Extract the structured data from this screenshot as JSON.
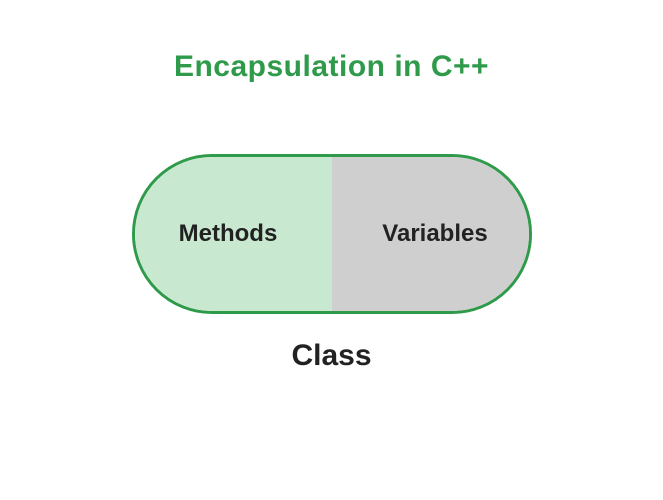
{
  "diagram": {
    "title": "Encapsulation in C++",
    "capsule": {
      "left_label": "Methods",
      "right_label": "Variables"
    },
    "bottom_label": "Class",
    "colors": {
      "accent_green": "#2e9a4a",
      "left_fill": "#c8e8d0",
      "right_fill": "#cfcfcf",
      "text_dark": "#222222"
    }
  }
}
